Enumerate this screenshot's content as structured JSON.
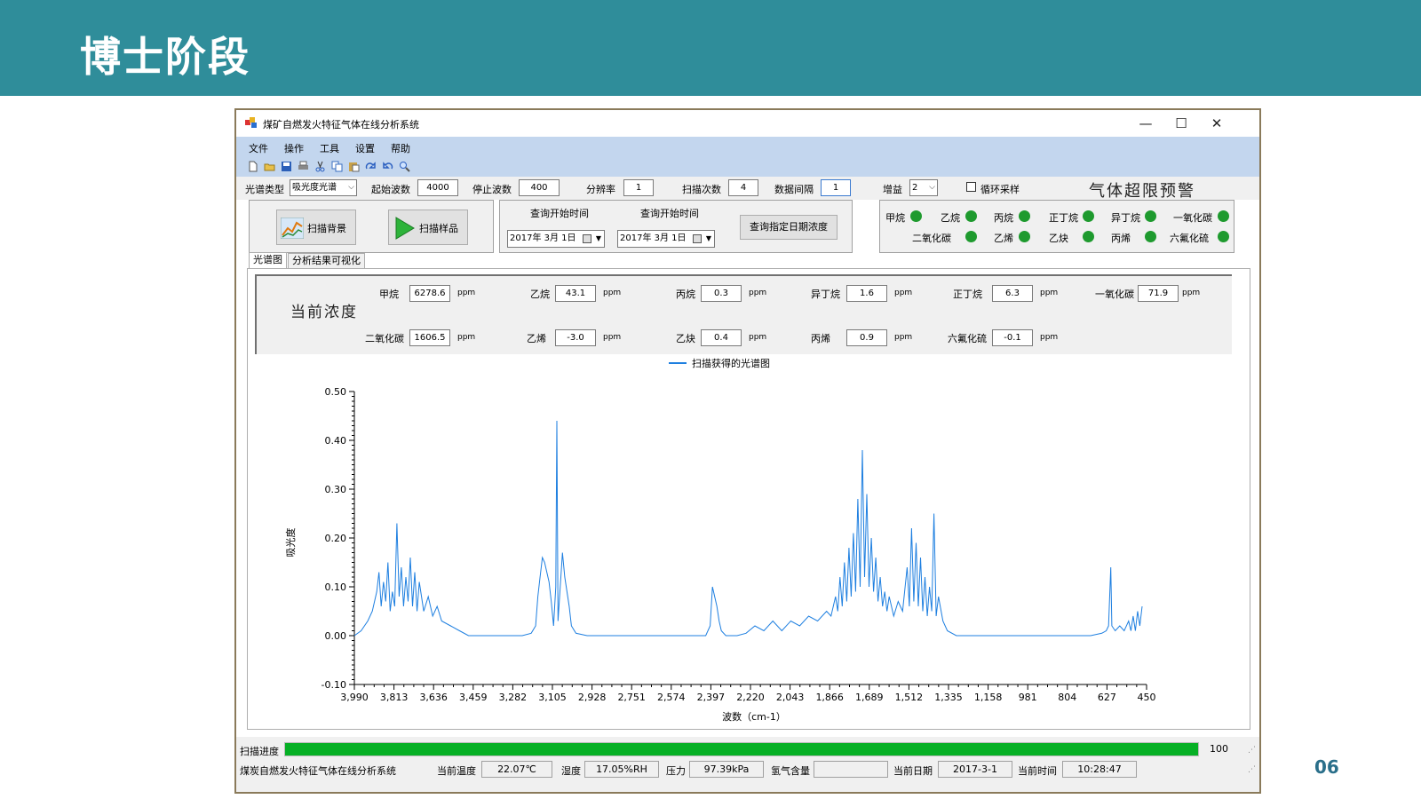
{
  "slide": {
    "title": "博士阶段",
    "page_number": "06"
  },
  "window": {
    "title": "煤矿自燃发火特征气体在线分析系统",
    "controls": {
      "minimize": "—",
      "maximize": "☐",
      "close": "✕"
    }
  },
  "menu": [
    "文件",
    "操作",
    "工具",
    "设置",
    "帮助"
  ],
  "toolbar_icons": [
    "new-file-icon",
    "open-folder-icon",
    "save-icon",
    "print-icon",
    "cut-icon",
    "copy-icon",
    "paste-icon",
    "redo-icon",
    "undo-icon",
    "search-icon"
  ],
  "params": {
    "spectrum_type_label": "光谱类型",
    "spectrum_type_value": "吸光度光谱",
    "start_wave_label": "起始波数",
    "start_wave_value": "4000",
    "stop_wave_label": "停止波数",
    "stop_wave_value": "400",
    "resolution_label": "分辨率",
    "resolution_value": "1",
    "scan_count_label": "扫描次数",
    "scan_count_value": "4",
    "data_interval_label": "数据间隔",
    "data_interval_value": "1",
    "gain_label": "增益",
    "gain_value": "2",
    "loop_sampling_label": "循环采样",
    "alarm_title": "气体超限预警"
  },
  "scan": {
    "background_label": "扫描背景",
    "sample_label": "扫描样品"
  },
  "query": {
    "start_label_1": "查询开始时间",
    "start_label_2": "查询开始时间",
    "date_1": "2017年 3月 1日",
    "date_2": "2017年 3月 1日",
    "button_label": "查询指定日期浓度"
  },
  "alarm_leds": {
    "row1": [
      "甲烷",
      "乙烷",
      "丙烷",
      "正丁烷",
      "异丁烷",
      "一氧化碳"
    ],
    "row2": [
      "二氧化碳",
      "乙烯",
      "乙炔",
      "丙烯",
      "六氟化硫"
    ]
  },
  "tabs": [
    "光谱图",
    "分析结果可视化"
  ],
  "concentration": {
    "title": "当前浓度",
    "unit": "ppm",
    "row1": [
      {
        "name": "甲烷",
        "value": "6278.6"
      },
      {
        "name": "乙烷",
        "value": "43.1"
      },
      {
        "name": "丙烷",
        "value": "0.3"
      },
      {
        "name": "异丁烷",
        "value": "1.6"
      },
      {
        "name": "正丁烷",
        "value": "6.3"
      },
      {
        "name": "一氧化碳",
        "value": "71.9"
      }
    ],
    "row2": [
      {
        "name": "二氧化碳",
        "value": "1606.5"
      },
      {
        "name": "乙烯",
        "value": "-3.0"
      },
      {
        "name": "乙炔",
        "value": "0.4"
      },
      {
        "name": "丙烯",
        "value": "0.9"
      },
      {
        "name": "六氟化硫",
        "value": "-0.1"
      }
    ]
  },
  "chart_data": {
    "type": "line",
    "legend": "扫描获得的光谱图",
    "xlabel": "波数（cm-1）",
    "ylabel": "吸光度",
    "xlim": [
      3990,
      450
    ],
    "ylim": [
      -0.1,
      0.5
    ],
    "x_ticks": [
      "3,990",
      "3,813",
      "3,636",
      "3,459",
      "3,282",
      "3,105",
      "2,928",
      "2,751",
      "2,574",
      "2,397",
      "2,220",
      "2,043",
      "1,866",
      "1,689",
      "1,512",
      "1,335",
      "1,158",
      "981",
      "804",
      "627",
      "450"
    ],
    "y_ticks": [
      "0.50",
      "0.40",
      "0.30",
      "0.20",
      "0.10",
      "0.00",
      "-0.10"
    ],
    "series": [
      {
        "color": "#1e7fe0",
        "points": [
          [
            3990,
            0.0
          ],
          [
            3960,
            0.01
          ],
          [
            3930,
            0.03
          ],
          [
            3910,
            0.05
          ],
          [
            3890,
            0.09
          ],
          [
            3880,
            0.13
          ],
          [
            3870,
            0.06
          ],
          [
            3860,
            0.11
          ],
          [
            3850,
            0.07
          ],
          [
            3840,
            0.15
          ],
          [
            3830,
            0.05
          ],
          [
            3820,
            0.09
          ],
          [
            3810,
            0.06
          ],
          [
            3800,
            0.23
          ],
          [
            3790,
            0.08
          ],
          [
            3780,
            0.14
          ],
          [
            3770,
            0.06
          ],
          [
            3760,
            0.12
          ],
          [
            3750,
            0.07
          ],
          [
            3740,
            0.16
          ],
          [
            3730,
            0.06
          ],
          [
            3720,
            0.13
          ],
          [
            3710,
            0.05
          ],
          [
            3700,
            0.11
          ],
          [
            3680,
            0.05
          ],
          [
            3660,
            0.08
          ],
          [
            3640,
            0.04
          ],
          [
            3620,
            0.06
          ],
          [
            3600,
            0.03
          ],
          [
            3560,
            0.02
          ],
          [
            3520,
            0.01
          ],
          [
            3480,
            0.0
          ],
          [
            3440,
            0.0
          ],
          [
            3400,
            0.0
          ],
          [
            3360,
            0.0
          ],
          [
            3320,
            0.0
          ],
          [
            3280,
            0.0
          ],
          [
            3240,
            0.0
          ],
          [
            3200,
            0.005
          ],
          [
            3180,
            0.02
          ],
          [
            3170,
            0.08
          ],
          [
            3160,
            0.12
          ],
          [
            3150,
            0.16
          ],
          [
            3140,
            0.15
          ],
          [
            3130,
            0.13
          ],
          [
            3120,
            0.11
          ],
          [
            3110,
            0.07
          ],
          [
            3100,
            0.02
          ],
          [
            3090,
            0.1
          ],
          [
            3085,
            0.44
          ],
          [
            3080,
            0.03
          ],
          [
            3070,
            0.1
          ],
          [
            3060,
            0.17
          ],
          [
            3050,
            0.12
          ],
          [
            3040,
            0.09
          ],
          [
            3030,
            0.06
          ],
          [
            3020,
            0.02
          ],
          [
            3000,
            0.005
          ],
          [
            2950,
            0.0
          ],
          [
            2900,
            0.0
          ],
          [
            2800,
            0.0
          ],
          [
            2700,
            0.0
          ],
          [
            2600,
            0.0
          ],
          [
            2500,
            0.0
          ],
          [
            2420,
            0.0
          ],
          [
            2400,
            0.02
          ],
          [
            2390,
            0.1
          ],
          [
            2380,
            0.08
          ],
          [
            2370,
            0.06
          ],
          [
            2360,
            0.03
          ],
          [
            2350,
            0.01
          ],
          [
            2330,
            0.0
          ],
          [
            2280,
            0.0
          ],
          [
            2240,
            0.005
          ],
          [
            2200,
            0.02
          ],
          [
            2160,
            0.01
          ],
          [
            2120,
            0.03
          ],
          [
            2080,
            0.01
          ],
          [
            2040,
            0.03
          ],
          [
            2000,
            0.02
          ],
          [
            1960,
            0.04
          ],
          [
            1920,
            0.03
          ],
          [
            1880,
            0.05
          ],
          [
            1860,
            0.04
          ],
          [
            1840,
            0.08
          ],
          [
            1830,
            0.05
          ],
          [
            1820,
            0.12
          ],
          [
            1810,
            0.06
          ],
          [
            1800,
            0.15
          ],
          [
            1790,
            0.07
          ],
          [
            1780,
            0.18
          ],
          [
            1770,
            0.08
          ],
          [
            1760,
            0.21
          ],
          [
            1750,
            0.09
          ],
          [
            1740,
            0.28
          ],
          [
            1730,
            0.1
          ],
          [
            1720,
            0.38
          ],
          [
            1710,
            0.12
          ],
          [
            1700,
            0.29
          ],
          [
            1690,
            0.1
          ],
          [
            1680,
            0.2
          ],
          [
            1670,
            0.09
          ],
          [
            1660,
            0.16
          ],
          [
            1650,
            0.07
          ],
          [
            1640,
            0.12
          ],
          [
            1630,
            0.06
          ],
          [
            1620,
            0.09
          ],
          [
            1610,
            0.05
          ],
          [
            1600,
            0.08
          ],
          [
            1580,
            0.04
          ],
          [
            1560,
            0.07
          ],
          [
            1540,
            0.05
          ],
          [
            1520,
            0.14
          ],
          [
            1510,
            0.06
          ],
          [
            1500,
            0.22
          ],
          [
            1490,
            0.07
          ],
          [
            1480,
            0.19
          ],
          [
            1470,
            0.06
          ],
          [
            1460,
            0.16
          ],
          [
            1450,
            0.05
          ],
          [
            1440,
            0.12
          ],
          [
            1430,
            0.04
          ],
          [
            1420,
            0.1
          ],
          [
            1410,
            0.05
          ],
          [
            1400,
            0.25
          ],
          [
            1390,
            0.04
          ],
          [
            1380,
            0.08
          ],
          [
            1360,
            0.03
          ],
          [
            1340,
            0.01
          ],
          [
            1300,
            0.0
          ],
          [
            1200,
            0.0
          ],
          [
            1100,
            0.0
          ],
          [
            1000,
            0.0
          ],
          [
            900,
            0.0
          ],
          [
            800,
            0.0
          ],
          [
            700,
            0.0
          ],
          [
            650,
            0.005
          ],
          [
            630,
            0.01
          ],
          [
            620,
            0.02
          ],
          [
            610,
            0.14
          ],
          [
            605,
            0.02
          ],
          [
            590,
            0.01
          ],
          [
            570,
            0.02
          ],
          [
            550,
            0.01
          ],
          [
            530,
            0.03
          ],
          [
            520,
            0.01
          ],
          [
            510,
            0.04
          ],
          [
            500,
            0.01
          ],
          [
            490,
            0.05
          ],
          [
            480,
            0.02
          ],
          [
            470,
            0.06
          ]
        ]
      }
    ]
  },
  "status": {
    "progress_label": "扫描进度",
    "progress_value": 100,
    "progress_text": "100",
    "system_name": "煤炭自燃发火特征气体在线分析系统",
    "temp_label": "当前温度",
    "temp_value": "22.07℃",
    "humidity_label": "湿度",
    "humidity_value": "17.05%RH",
    "pressure_label": "压力",
    "pressure_value": "97.39kPa",
    "hydrogen_label": "氢气含量",
    "hydrogen_value": "",
    "date_label": "当前日期",
    "date_value": "2017-3-1",
    "time_label": "当前时间",
    "time_value": "10:28:47"
  }
}
